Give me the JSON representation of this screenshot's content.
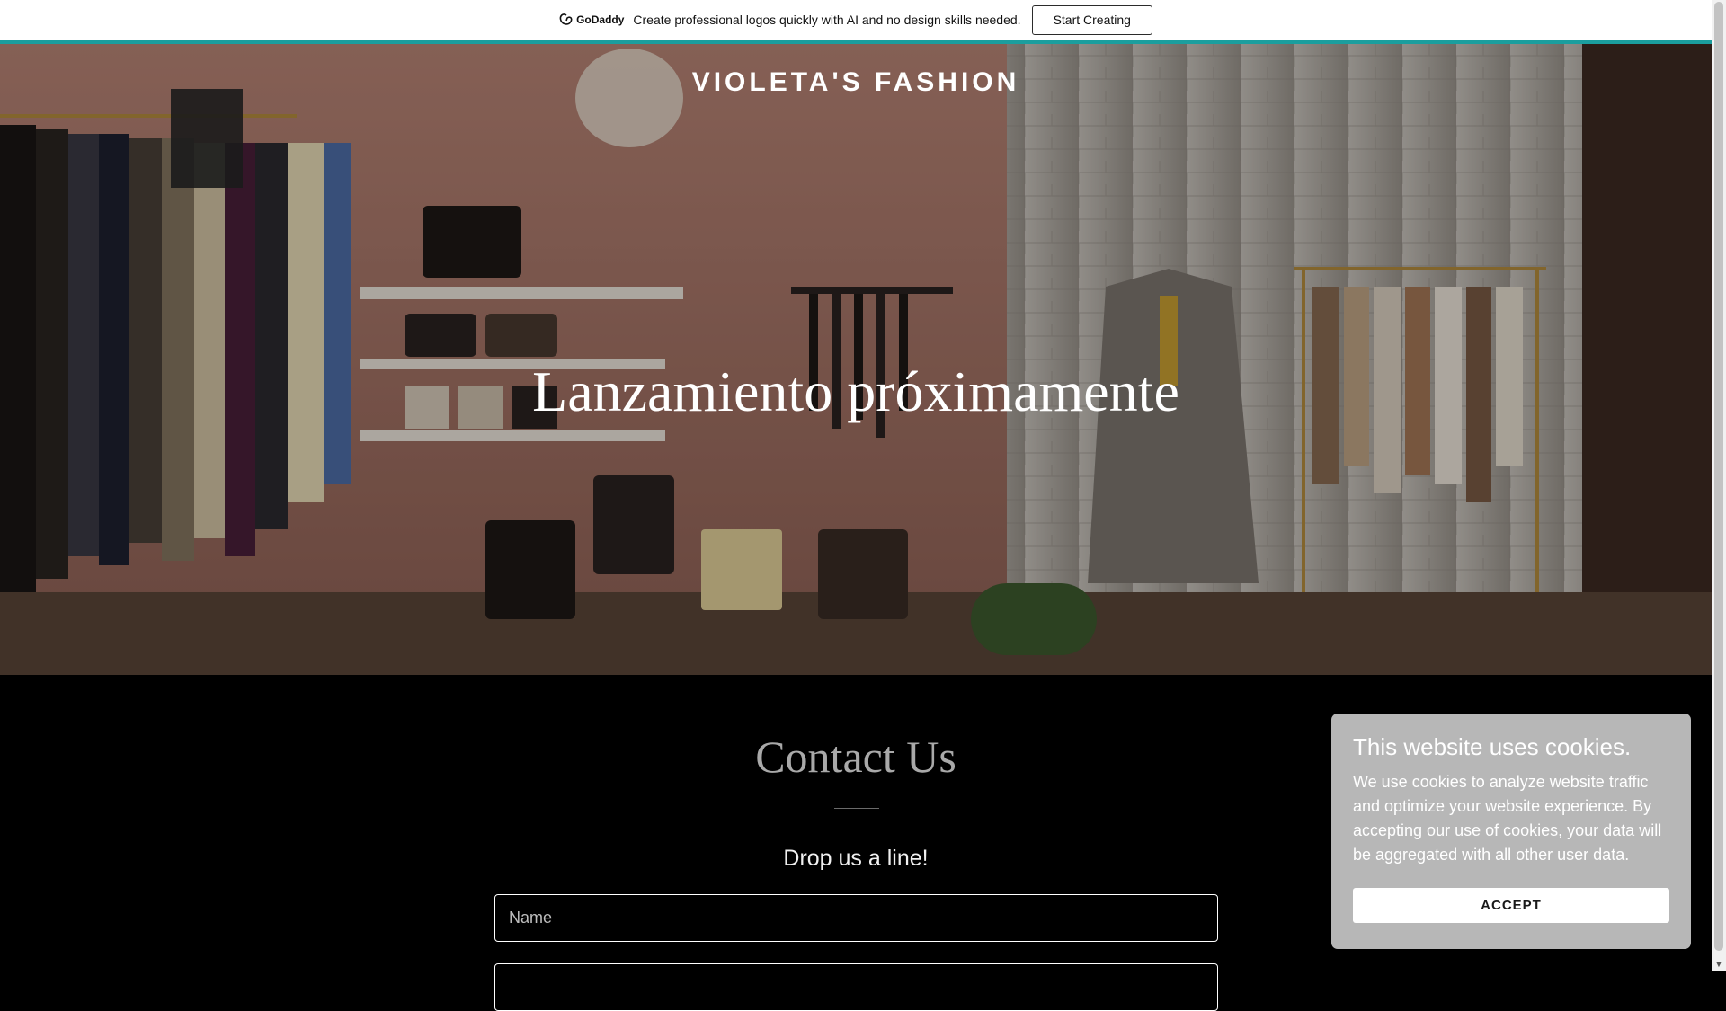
{
  "promo": {
    "logo_text": "GoDaddy",
    "message": "Create professional logos quickly with AI and no design skills needed.",
    "button_label": "Start Creating"
  },
  "hero": {
    "brand": "VIOLETA'S FASHION",
    "title": "Lanzamiento próximamente"
  },
  "contact": {
    "title": "Contact Us",
    "subheading": "Drop us a line!",
    "name_placeholder": "Name"
  },
  "cookie": {
    "title": "This website uses cookies.",
    "body": "We use cookies to analyze website traffic and optimize your website experience. By accepting our use of cookies, your data will be aggregated with all other user data.",
    "accept_label": "ACCEPT"
  },
  "colors": {
    "accent": "#1b9e9e",
    "background": "#000000",
    "cookie_panel": "#b7b7b7"
  }
}
